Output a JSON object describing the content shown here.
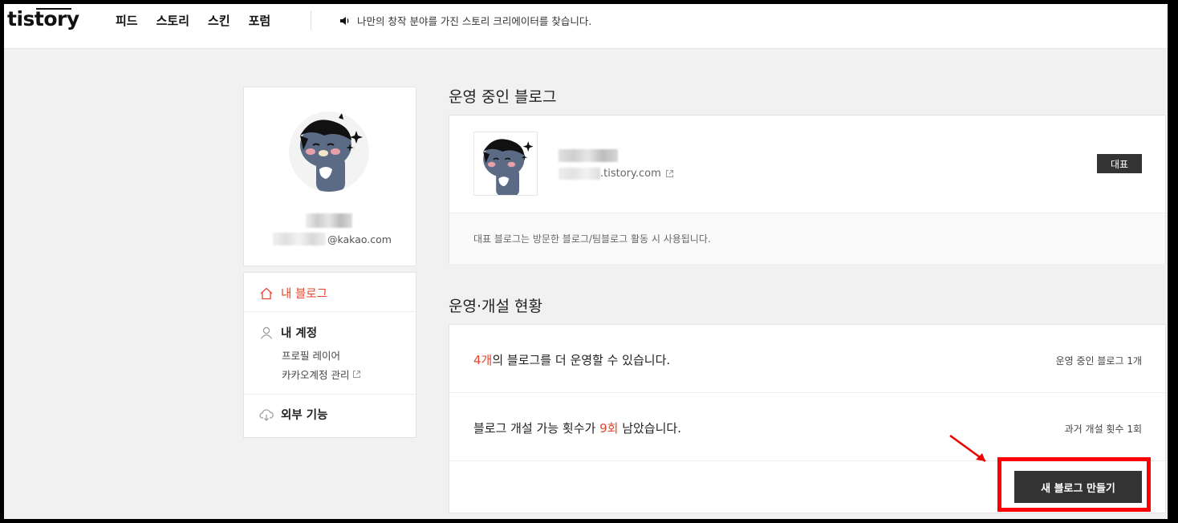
{
  "header": {
    "logo": "tistory",
    "nav": [
      "피드",
      "스토리",
      "스킨",
      "포럼"
    ],
    "notice": "나만의 창작 분야를 가진 스토리 크리에이터를 찾습니다."
  },
  "profile": {
    "email_domain": "@kakao.com"
  },
  "menu": {
    "my_blog": "내 블로그",
    "my_account": "내 계정",
    "profile_layer": "프로필 레이어",
    "kakao_account": "카카오계정 관리",
    "external": "외부 기능"
  },
  "blogs": {
    "title": "운영 중인 블로그",
    "url_suffix": ".tistory.com",
    "badge": "대표",
    "footer_note": "대표 블로그는 방문한 블로그/팀블로그 활동 시 사용됩니다."
  },
  "status": {
    "title": "운영·개설 현황",
    "row1_count": "4개",
    "row1_text": "의 블로그를 더 운영할 수 있습니다.",
    "row1_side": "운영 중인 블로그 1개",
    "row2_pre": "블로그 개설 가능 횟수가 ",
    "row2_count": "9회",
    "row2_post": " 남았습니다.",
    "row2_side": "과거 개설 횟수 1회",
    "create_button": "새 블로그 만들기"
  },
  "colors": {
    "accent": "#e5452e",
    "highlight": "#ff0000",
    "button": "#333333"
  }
}
